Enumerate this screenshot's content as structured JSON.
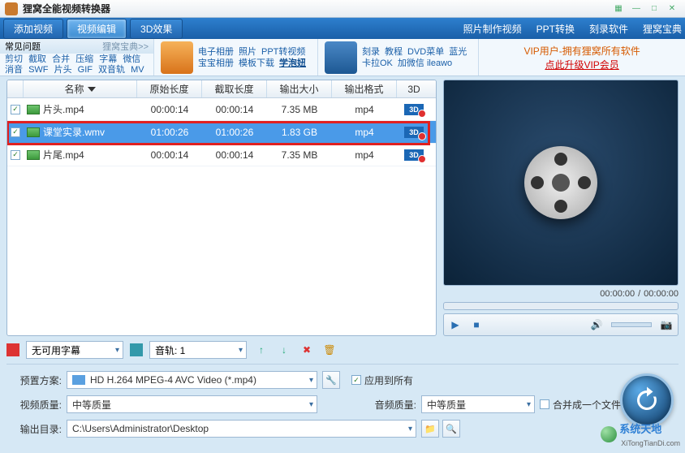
{
  "title": "狸窝全能视频转换器",
  "tabs": {
    "add": "添加视频",
    "edit": "视频编辑",
    "fx": "3D效果"
  },
  "toplinks": {
    "photo": "照片制作视频",
    "ppt": "PPT转换",
    "burn": "刻录软件",
    "guide": "狸窝宝典"
  },
  "faq": {
    "head": "常见问题",
    "headlink": "狸窝宝典>>",
    "items": [
      "剪切",
      "截取",
      "合并",
      "压缩",
      "字幕",
      "微信",
      "消音",
      "SWF",
      "片头",
      "GIF",
      "双音轨",
      "MV"
    ]
  },
  "block1": {
    "row1": [
      "电子相册",
      "照片",
      "PPT转视频"
    ],
    "row2": [
      "宝宝相册",
      "模板下载"
    ],
    "bold": "学泡妞"
  },
  "block2": {
    "row1": [
      "刻录",
      "教程",
      "DVD菜单",
      "蓝光"
    ],
    "row2": [
      "卡拉OK",
      "加微信 ileawo"
    ]
  },
  "vip": {
    "t1": "VIP用户-拥有狸窝所有软件",
    "t2": "点此升级VIP会员"
  },
  "cols": {
    "name": "名称",
    "orig": "原始长度",
    "clip": "截取长度",
    "size": "输出大小",
    "fmt": "输出格式",
    "d3": "3D"
  },
  "rows": [
    {
      "name": "片头.mp4",
      "orig": "00:00:14",
      "clip": "00:00:14",
      "size": "7.35 MB",
      "fmt": "mp4"
    },
    {
      "name": "课堂实录.wmv",
      "orig": "01:00:26",
      "clip": "01:00:26",
      "size": "1.83 GB",
      "fmt": "mp4"
    },
    {
      "name": "片尾.mp4",
      "orig": "00:00:14",
      "clip": "00:00:14",
      "size": "7.35 MB",
      "fmt": "mp4"
    }
  ],
  "subtitle": "无可用字幕",
  "audiotrack_label": "音轨",
  "audiotrack_value": "音轨: 1",
  "time": {
    "cur": "00:00:00",
    "sep": "/",
    "tot": "00:00:00"
  },
  "settings": {
    "preset_l": "预置方案:",
    "preset_v": "HD H.264 MPEG-4 AVC Video (*.mp4)",
    "vq_l": "视频质量:",
    "vq_v": "中等质量",
    "aq_l": "音频质量:",
    "aq_v": "中等质量",
    "out_l": "输出目录:",
    "out_v": "C:\\Users\\Administrator\\Desktop",
    "applyall": "应用到所有",
    "merge": "合并成一个文件"
  },
  "watermark": {
    "name": "系统天地",
    "url": "XiTongTianDi.com"
  }
}
